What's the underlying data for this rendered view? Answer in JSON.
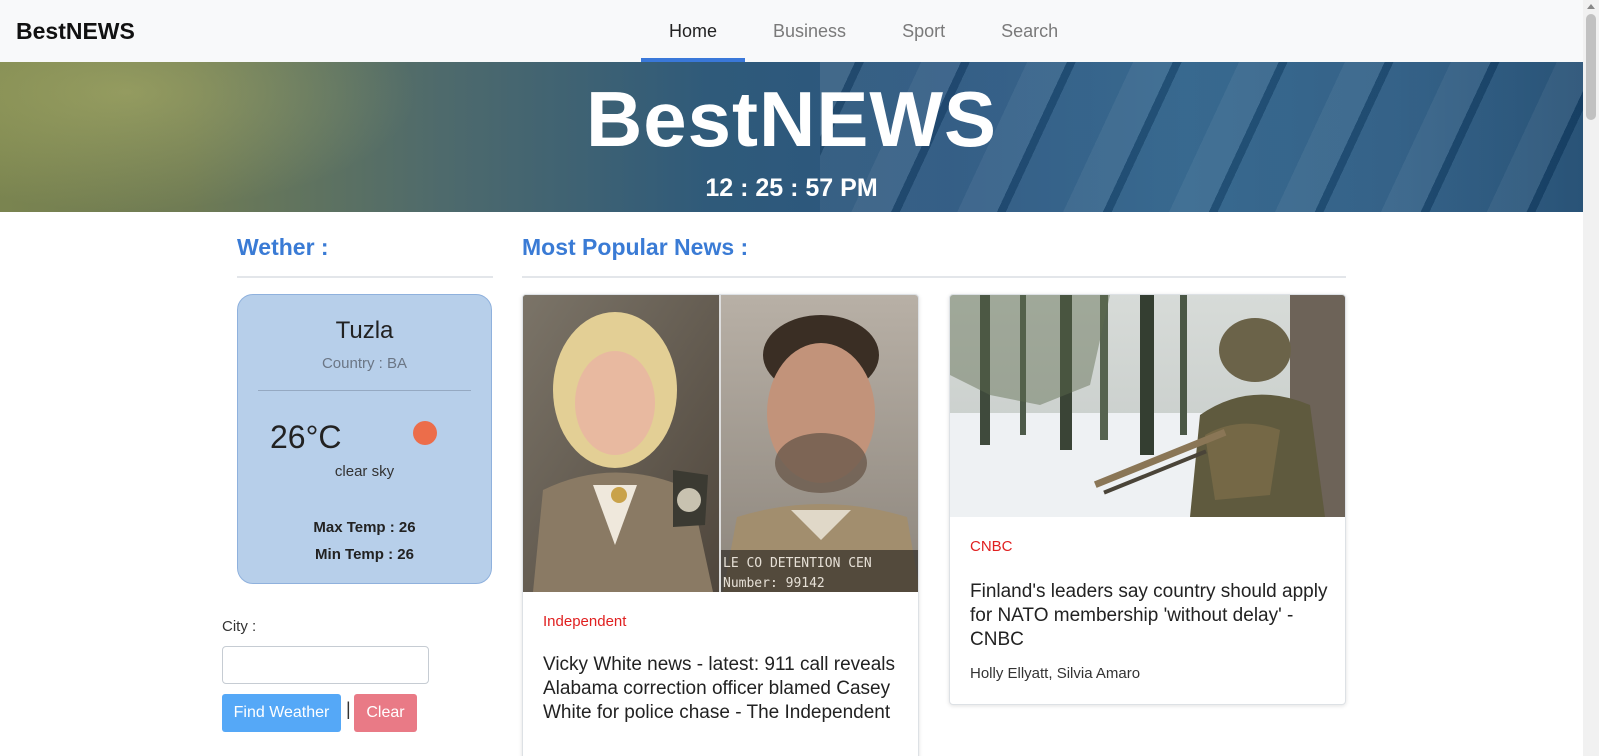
{
  "navbar": {
    "brand": "BestNEWS",
    "items": [
      {
        "label": "Home",
        "active": true
      },
      {
        "label": "Business",
        "active": false
      },
      {
        "label": "Sport",
        "active": false
      },
      {
        "label": "Search",
        "active": false
      }
    ]
  },
  "hero": {
    "title": "BestNEWS",
    "clock": "12 : 25 : 57 PM"
  },
  "weather": {
    "heading": "Wether :",
    "city": "Tuzla",
    "country": "Country : BA",
    "temp": "26°C",
    "icon": "sun-icon",
    "description": "clear sky",
    "max_temp": "Max Temp : 26",
    "min_temp": "Min Temp : 26",
    "form": {
      "label": "City :",
      "input_value": "",
      "find_label": "Find Weather",
      "separator": "|",
      "clear_label": "Clear"
    }
  },
  "news": {
    "heading": "Most Popular News :",
    "articles": [
      {
        "source": "Independent",
        "title": "Vicky White news - latest: 911 call reveals Alabama correction officer blamed Casey White for police chase - The Independent",
        "author": "",
        "image_text": "LE CO DETENTION CEN Number: 99142"
      },
      {
        "source": "CNBC",
        "title": "Finland's leaders say country should apply for NATO membership 'without delay' - CNBC",
        "author": "Holly Ellyatt, Silvia Amaro"
      }
    ]
  },
  "colors": {
    "accent": "#3a7bd5",
    "source_red": "#e02020",
    "find_button": "#55a8f7",
    "clear_button": "#e97a86",
    "weather_card": "#b7cfea"
  }
}
